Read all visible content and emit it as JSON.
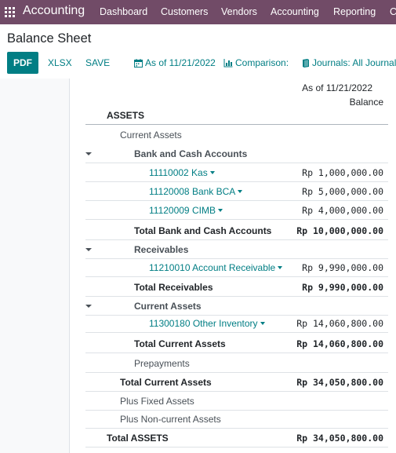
{
  "navbar": {
    "app_name": "Accounting",
    "menu": [
      "Dashboard",
      "Customers",
      "Vendors",
      "Accounting",
      "Reporting",
      "C"
    ]
  },
  "control": {
    "title": "Balance Sheet",
    "buttons": {
      "pdf": "PDF",
      "xlsx": "XLSX",
      "save": "SAVE"
    },
    "filters": {
      "date": "As of 11/21/2022",
      "comparison": "Comparison:",
      "journals": "Journals: All Journal"
    }
  },
  "report": {
    "column_date": "As of 11/21/2022",
    "column_label": "Balance",
    "section": "ASSETS",
    "rows": [
      {
        "label": "Current Assets",
        "amount": ""
      },
      {
        "label": "Bank and Cash Accounts",
        "amount": ""
      },
      {
        "label": "11110002 Kas",
        "amount": "Rp 1,000,000.00"
      },
      {
        "label": "11120008 Bank BCA",
        "amount": "Rp 5,000,000.00"
      },
      {
        "label": "11120009 CIMB",
        "amount": "Rp 4,000,000.00"
      },
      {
        "label": "Total Bank and Cash Accounts",
        "amount": "Rp 10,000,000.00"
      },
      {
        "label": "Receivables",
        "amount": ""
      },
      {
        "label": "11210010 Account Receivable",
        "amount": "Rp 9,990,000.00"
      },
      {
        "label": "Total Receivables",
        "amount": "Rp 9,990,000.00"
      },
      {
        "label": "Current Assets",
        "amount": ""
      },
      {
        "label": "11300180 Other Inventory",
        "amount": "Rp 14,060,800.00"
      },
      {
        "label": "Total Current Assets",
        "amount": "Rp 14,060,800.00"
      },
      {
        "label": "Prepayments",
        "amount": ""
      },
      {
        "label": "Total Current Assets",
        "amount": "Rp 34,050,800.00"
      },
      {
        "label": "Plus Fixed Assets",
        "amount": ""
      },
      {
        "label": "Plus Non-current Assets",
        "amount": ""
      },
      {
        "label": "Total ASSETS",
        "amount": "Rp 34,050,800.00"
      }
    ]
  },
  "colors": {
    "navbar": "#714b67",
    "accent": "#017e84"
  },
  "icons": {
    "apps": "grid-icon",
    "date": "calendar-icon",
    "comparison": "bar-chart-icon",
    "journals": "book-icon"
  }
}
